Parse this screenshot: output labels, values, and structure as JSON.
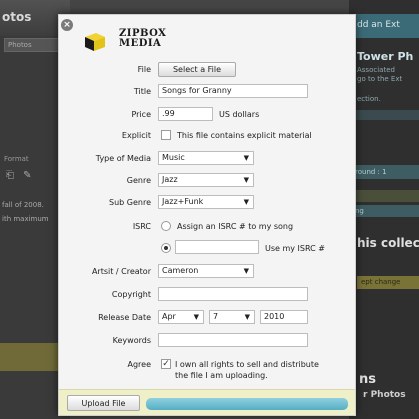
{
  "background_left": {
    "title": "otos",
    "field": "Photos",
    "tabbar": "Format",
    "tools": "⎗ ✎",
    "text_lines": [
      "fall of 2008.",
      "ith maximum"
    ]
  },
  "background_right": {
    "header": "dd an Ext",
    "title": "Tower Ph",
    "sub_lines": [
      "Associated",
      "go to the Ext"
    ],
    "link": "ection.",
    "section1": "round : 1",
    "section3": "ng",
    "big_heading": "his collec",
    "button": "ept change",
    "ns_heading": "ns",
    "photos_label": "r Photos"
  },
  "brand": {
    "line1": "ZIPBOX",
    "line2": "MEDIA"
  },
  "close_icon": "×",
  "form": {
    "file_label": "File",
    "select_file_button": "Select a File",
    "title_label": "Title",
    "title_value": "Songs for Granny",
    "price_label": "Price",
    "price_value": ".99",
    "price_unit": "US dollars",
    "explicit_label": "Explicit",
    "explicit_text": "This file contains explicit material",
    "explicit_checked": false,
    "media_label": "Type of Media",
    "media_value": "Music",
    "genre_label": "Genre",
    "genre_value": "Jazz",
    "subgenre_label": "Sub Genre",
    "subgenre_value": "Jazz+Funk",
    "isrc_label": "ISRC",
    "isrc_assign_text": "Assign an ISRC # to my song",
    "isrc_assign_selected": false,
    "isrc_own_value": "",
    "isrc_own_text": "Use my ISRC #",
    "isrc_own_selected": true,
    "artist_label": "Artsit / Creator",
    "artist_value": "Cameron",
    "copyright_label": "Copyright",
    "copyright_value": "",
    "release_label": "Release Date",
    "release_month": "Apr",
    "release_day": "7",
    "release_year": "2010",
    "keywords_label": "Keywords",
    "keywords_value": "",
    "agree_label": "Agree",
    "agree_text_line1": "I own all rights to sell and distribute",
    "agree_text_line2": "the file I am uploading.",
    "agree_checked": true,
    "caret_icon": "▼",
    "check_icon": "✓"
  },
  "footer": {
    "upload_button": "Upload File",
    "progress": 1.0
  }
}
